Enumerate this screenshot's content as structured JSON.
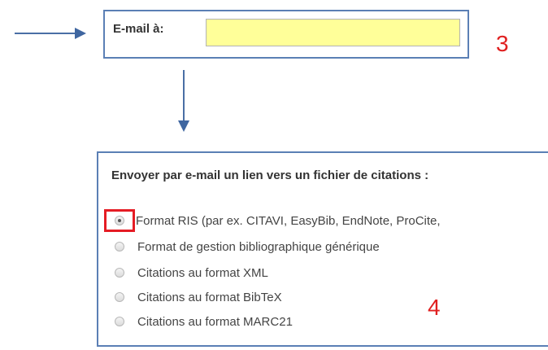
{
  "email": {
    "label": "E-mail à:",
    "value": "",
    "placeholder": ""
  },
  "markers": {
    "step3": "3",
    "step4": "4"
  },
  "options": {
    "heading": "Envoyer par e-mail un lien vers un fichier de citations :",
    "selected_index": 0,
    "items": [
      {
        "label": "Format RIS (par ex. CITAVI, EasyBib, EndNote, ProCite,",
        "checked": true
      },
      {
        "label": "Format de gestion bibliographique générique",
        "checked": false
      },
      {
        "label": "Citations au format XML",
        "checked": false
      },
      {
        "label": "Citations au format BibTeX",
        "checked": false
      },
      {
        "label": "Citations au format MARC21",
        "checked": false
      }
    ]
  },
  "colors": {
    "input_background": "#ffff99",
    "box_border": "#5b7fb5",
    "arrow": "#4a6fa5",
    "highlight": "#e51c24",
    "marker_text": "#e02020"
  }
}
